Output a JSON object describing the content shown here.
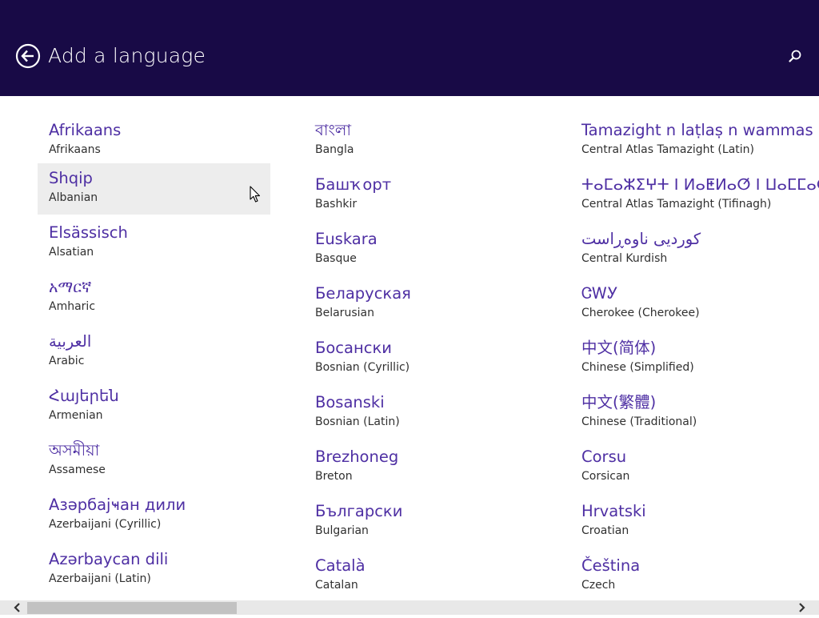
{
  "header": {
    "title": "Add a language",
    "back_icon": "back-arrow-icon",
    "search_icon": "search-icon",
    "background": "#180a46"
  },
  "columns": [
    {
      "items": [
        {
          "native": "Afrikaans",
          "english": "Afrikaans"
        },
        {
          "native": "Shqip",
          "english": "Albanian",
          "hovered": true
        },
        {
          "native": "Elsässisch",
          "english": "Alsatian"
        },
        {
          "native": "አማርኛ",
          "english": "Amharic"
        },
        {
          "native": "العربية",
          "english": "Arabic"
        },
        {
          "native": "Հայերեն",
          "english": "Armenian"
        },
        {
          "native": "অসমীয়া",
          "english": "Assamese"
        },
        {
          "native": "Азәрбајҹан дили",
          "english": "Azerbaijani (Cyrillic)"
        },
        {
          "native": "Azərbaycan dili",
          "english": "Azerbaijani (Latin)"
        }
      ]
    },
    {
      "items": [
        {
          "native": "বাংলা",
          "english": "Bangla"
        },
        {
          "native": "Башҡорт",
          "english": "Bashkir"
        },
        {
          "native": "Euskara",
          "english": "Basque"
        },
        {
          "native": "Беларуская",
          "english": "Belarusian"
        },
        {
          "native": "Босански",
          "english": "Bosnian (Cyrillic)"
        },
        {
          "native": "Bosanski",
          "english": "Bosnian (Latin)"
        },
        {
          "native": "Brezhoneg",
          "english": "Breton"
        },
        {
          "native": "Български",
          "english": "Bulgarian"
        },
        {
          "native": "Català",
          "english": "Catalan"
        }
      ]
    },
    {
      "items": [
        {
          "native": "Tamazight n laṭlaṣ n wammas",
          "english": "Central Atlas Tamazight (Latin)"
        },
        {
          "native": "ⵜⴰⵎⴰⵣⵉⵖⵜ ⵏ ⵍⴰⵟⵍⴰⵚ ⵏ ⵡⴰⵎⵎⴰⵙ",
          "english": "Central Atlas Tamazight (Tifinagh)"
        },
        {
          "native": "کوردیی ناوەڕاست",
          "english": "Central Kurdish"
        },
        {
          "native": "ᏣᎳᎩ",
          "english": "Cherokee (Cherokee)"
        },
        {
          "native": "中文(简体)",
          "english": "Chinese (Simplified)"
        },
        {
          "native": "中文(繁體)",
          "english": "Chinese (Traditional)"
        },
        {
          "native": "Corsu",
          "english": "Corsican"
        },
        {
          "native": "Hrvatski",
          "english": "Croatian"
        },
        {
          "native": "Čeština",
          "english": "Czech"
        }
      ]
    }
  ],
  "scrollbar": {
    "left_icon": "chevron-left-icon",
    "right_icon": "chevron-right-icon",
    "color": "#c2c2c2"
  },
  "colors": {
    "accent": "#4e2fa3",
    "secondary_text": "#303030",
    "hover_background": "#ededed"
  }
}
